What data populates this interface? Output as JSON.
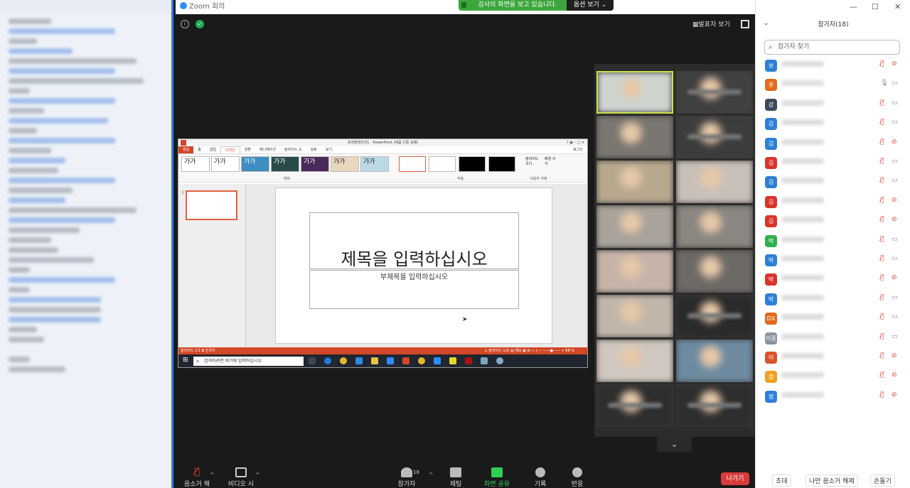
{
  "window": {
    "title": "Zoom 회의"
  },
  "banner": {
    "text": "강사의 화면을 보고 있습니다.",
    "options": "옵션 보기 ⌄"
  },
  "view": {
    "presenter_label": "발표자 보기"
  },
  "ppt": {
    "window_title": "프레젠테이션1 - PowerPoint (제품 인증 실패)",
    "tabs": [
      "파일",
      "홈",
      "삽입",
      "디자인",
      "전환",
      "애니메이션",
      "슬라이드 쇼",
      "검토",
      "보기"
    ],
    "sign_in": "로그인",
    "theme_label": "테마",
    "variant_label": "적용",
    "customize_label": "사용자 지정",
    "slide_size": "슬라이드 크기 ·",
    "bg_format": "배경 서식",
    "theme_sample": "가가",
    "slide_number": "1",
    "slide_title": "제목을 입력하십시오",
    "slide_subtitle": "부제목을 입력하십시오",
    "status_left": "슬라이드 1/1   ⧉   한국어",
    "status_right": "⚠ 슬라이드 노트   ▤ 메모    ▣  ⊞  ▭  ▯    −  ——●——  +   68 %",
    "taskbar_search": "검색하려면 여기에 입력하십시오."
  },
  "toolbar": {
    "mute": "음소거 해제",
    "video": "비디오 시작",
    "participants": "참가자",
    "participants_count": "18",
    "chat": "채팅",
    "share": "화면 공유",
    "record": "기록",
    "reactions": "반응",
    "leave": "나가기"
  },
  "participants": {
    "header": "참가자(18)",
    "search_placeholder": "참가자 찾기",
    "list": [
      {
        "initial": "보",
        "color": "#2e7fd6",
        "mic": "muted",
        "cam": "off"
      },
      {
        "initial": "유",
        "color": "#e26a1b",
        "mic": "on",
        "cam": "on"
      },
      {
        "initial": "강",
        "color": "#3d4a5c",
        "mic": "muted",
        "cam": "on"
      },
      {
        "initial": "김",
        "color": "#2e7fd6",
        "mic": "muted",
        "cam": "on"
      },
      {
        "initial": "김",
        "color": "#2e7fd6",
        "mic": "muted",
        "cam": "off"
      },
      {
        "initial": "김",
        "color": "#d9342b",
        "mic": "muted",
        "cam": "on"
      },
      {
        "initial": "김",
        "color": "#2e7fd6",
        "mic": "muted",
        "cam": "on"
      },
      {
        "initial": "김",
        "color": "#d9342b",
        "mic": "muted",
        "cam": "off"
      },
      {
        "initial": "김",
        "color": "#d9342b",
        "mic": "muted",
        "cam": "off"
      },
      {
        "initial": "박",
        "color": "#2fb04a",
        "mic": "muted",
        "cam": "on"
      },
      {
        "initial": "박",
        "color": "#2e7fd6",
        "mic": "muted",
        "cam": "on"
      },
      {
        "initial": "박",
        "color": "#d9342b",
        "mic": "muted",
        "cam": "off"
      },
      {
        "initial": "박",
        "color": "#2e7fd6",
        "mic": "muted",
        "cam": "on"
      },
      {
        "initial": "DX",
        "color": "#e26a1b",
        "mic": "muted",
        "cam": "on"
      },
      {
        "initial": "이종",
        "color": "#8a94a0",
        "mic": "muted",
        "cam": "on"
      },
      {
        "initial": "이",
        "color": "#d9542b",
        "mic": "muted",
        "cam": "off"
      },
      {
        "initial": "정",
        "color": "#f0a020",
        "mic": "muted",
        "cam": "off"
      },
      {
        "initial": "정",
        "color": "#2e7fd6",
        "mic": "muted",
        "cam": "off"
      }
    ],
    "footer": {
      "invite": "초대",
      "unmute_me": "나만 음소거 해제",
      "raise_hand": "손들기"
    }
  }
}
